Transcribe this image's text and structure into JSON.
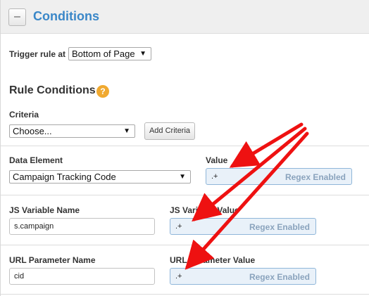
{
  "header": {
    "collapse_symbol": "–",
    "title": "Conditions"
  },
  "trigger": {
    "label": "Trigger rule at",
    "selected": "Bottom of Page"
  },
  "rule_conditions": {
    "title": "Rule Conditions",
    "help_symbol": "?"
  },
  "criteria": {
    "label": "Criteria",
    "selected": "Choose...",
    "add_button": "Add Criteria"
  },
  "data_element": {
    "name_label": "Data Element",
    "name_selected": "Campaign Tracking Code",
    "value_label": "Value",
    "value": ".+",
    "regex_label": "Regex Enabled"
  },
  "js_variable": {
    "name_label": "JS Variable Name",
    "name_value": "s.campaign",
    "value_label": "JS Variable Value",
    "value": ".+",
    "regex_label": "Regex Enabled"
  },
  "url_parameter": {
    "name_label": "URL Parameter Name",
    "name_value": "cid",
    "value_label": "URL Parameter Value",
    "value": ".+",
    "regex_label": "Regex Enabled"
  },
  "colors": {
    "accent": "#3a87c8",
    "arrow": "#ee1111",
    "help": "#f0a930"
  }
}
